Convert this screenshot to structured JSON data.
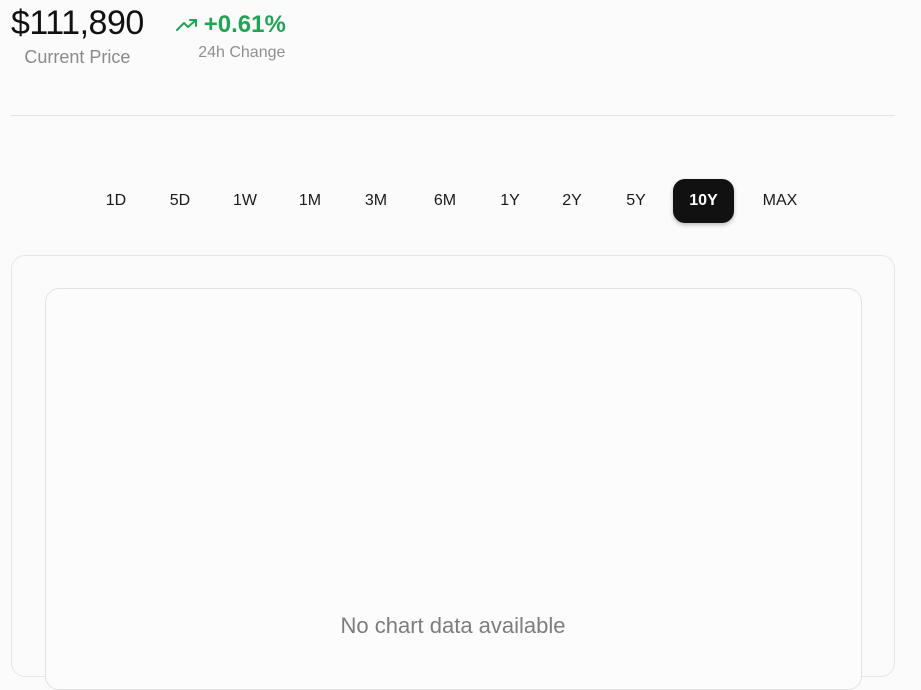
{
  "price": {
    "value": "$111,890",
    "label": "Current Price"
  },
  "change": {
    "value": "+0.61%",
    "label": "24h Change",
    "icon": "trending-up-icon",
    "color": "#22a355"
  },
  "ranges": {
    "items": [
      "1D",
      "5D",
      "1W",
      "1M",
      "3M",
      "6M",
      "1Y",
      "2Y",
      "5Y",
      "10Y",
      "MAX"
    ],
    "selected": "10Y"
  },
  "chart": {
    "empty_message": "No chart data available"
  }
}
